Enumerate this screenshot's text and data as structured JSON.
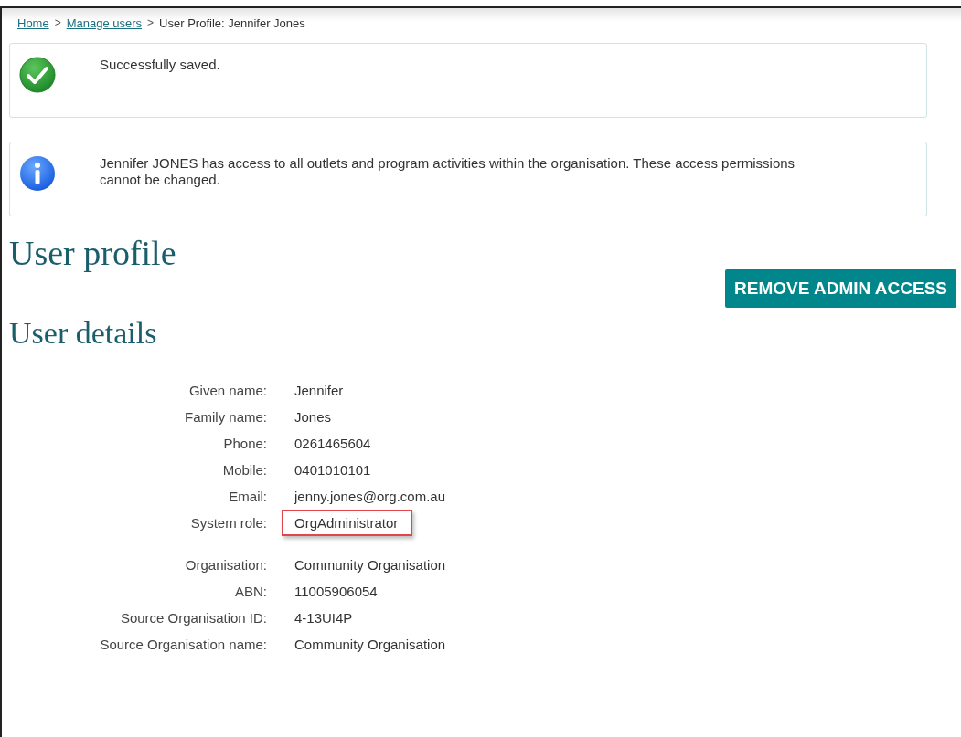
{
  "breadcrumb": [
    {
      "label": "Home",
      "kind": "link"
    },
    {
      "label": "Manage users",
      "kind": "link"
    },
    {
      "label": "User Profile: Jennifer Jones",
      "kind": "current"
    }
  ],
  "breadcrumb_separator": ">",
  "alerts": [
    {
      "kind": "success",
      "message": "Successfully saved."
    },
    {
      "kind": "info",
      "message": "Jennifer JONES has access to all outlets and program activities within the organisation. These access permissions cannot be changed."
    }
  ],
  "page_title": "User profile",
  "action_button": "REMOVE ADMIN ACCESS",
  "section_title": "User details",
  "field_groups": [
    [
      {
        "label": "Given name:",
        "value": "Jennifer",
        "highlighted": false
      },
      {
        "label": "Family name:",
        "value": "Jones",
        "highlighted": false
      },
      {
        "label": "Phone:",
        "value": "0261465604",
        "highlighted": false
      },
      {
        "label": "Mobile:",
        "value": "0401010101",
        "highlighted": false
      },
      {
        "label": "Email:",
        "value": "jenny.jones@org.com.au",
        "highlighted": false
      },
      {
        "label": "System role:",
        "value": "OrgAdministrator",
        "highlighted": true
      }
    ],
    [
      {
        "label": "Organisation:",
        "value": "Community Organisation",
        "highlighted": false
      },
      {
        "label": "ABN:",
        "value": "11005906054",
        "highlighted": false
      },
      {
        "label": "Source Organisation ID:",
        "value": "4-13UI4P",
        "highlighted": false
      },
      {
        "label": "Source Organisation name:",
        "value": "Community Organisation",
        "highlighted": false
      }
    ]
  ]
}
